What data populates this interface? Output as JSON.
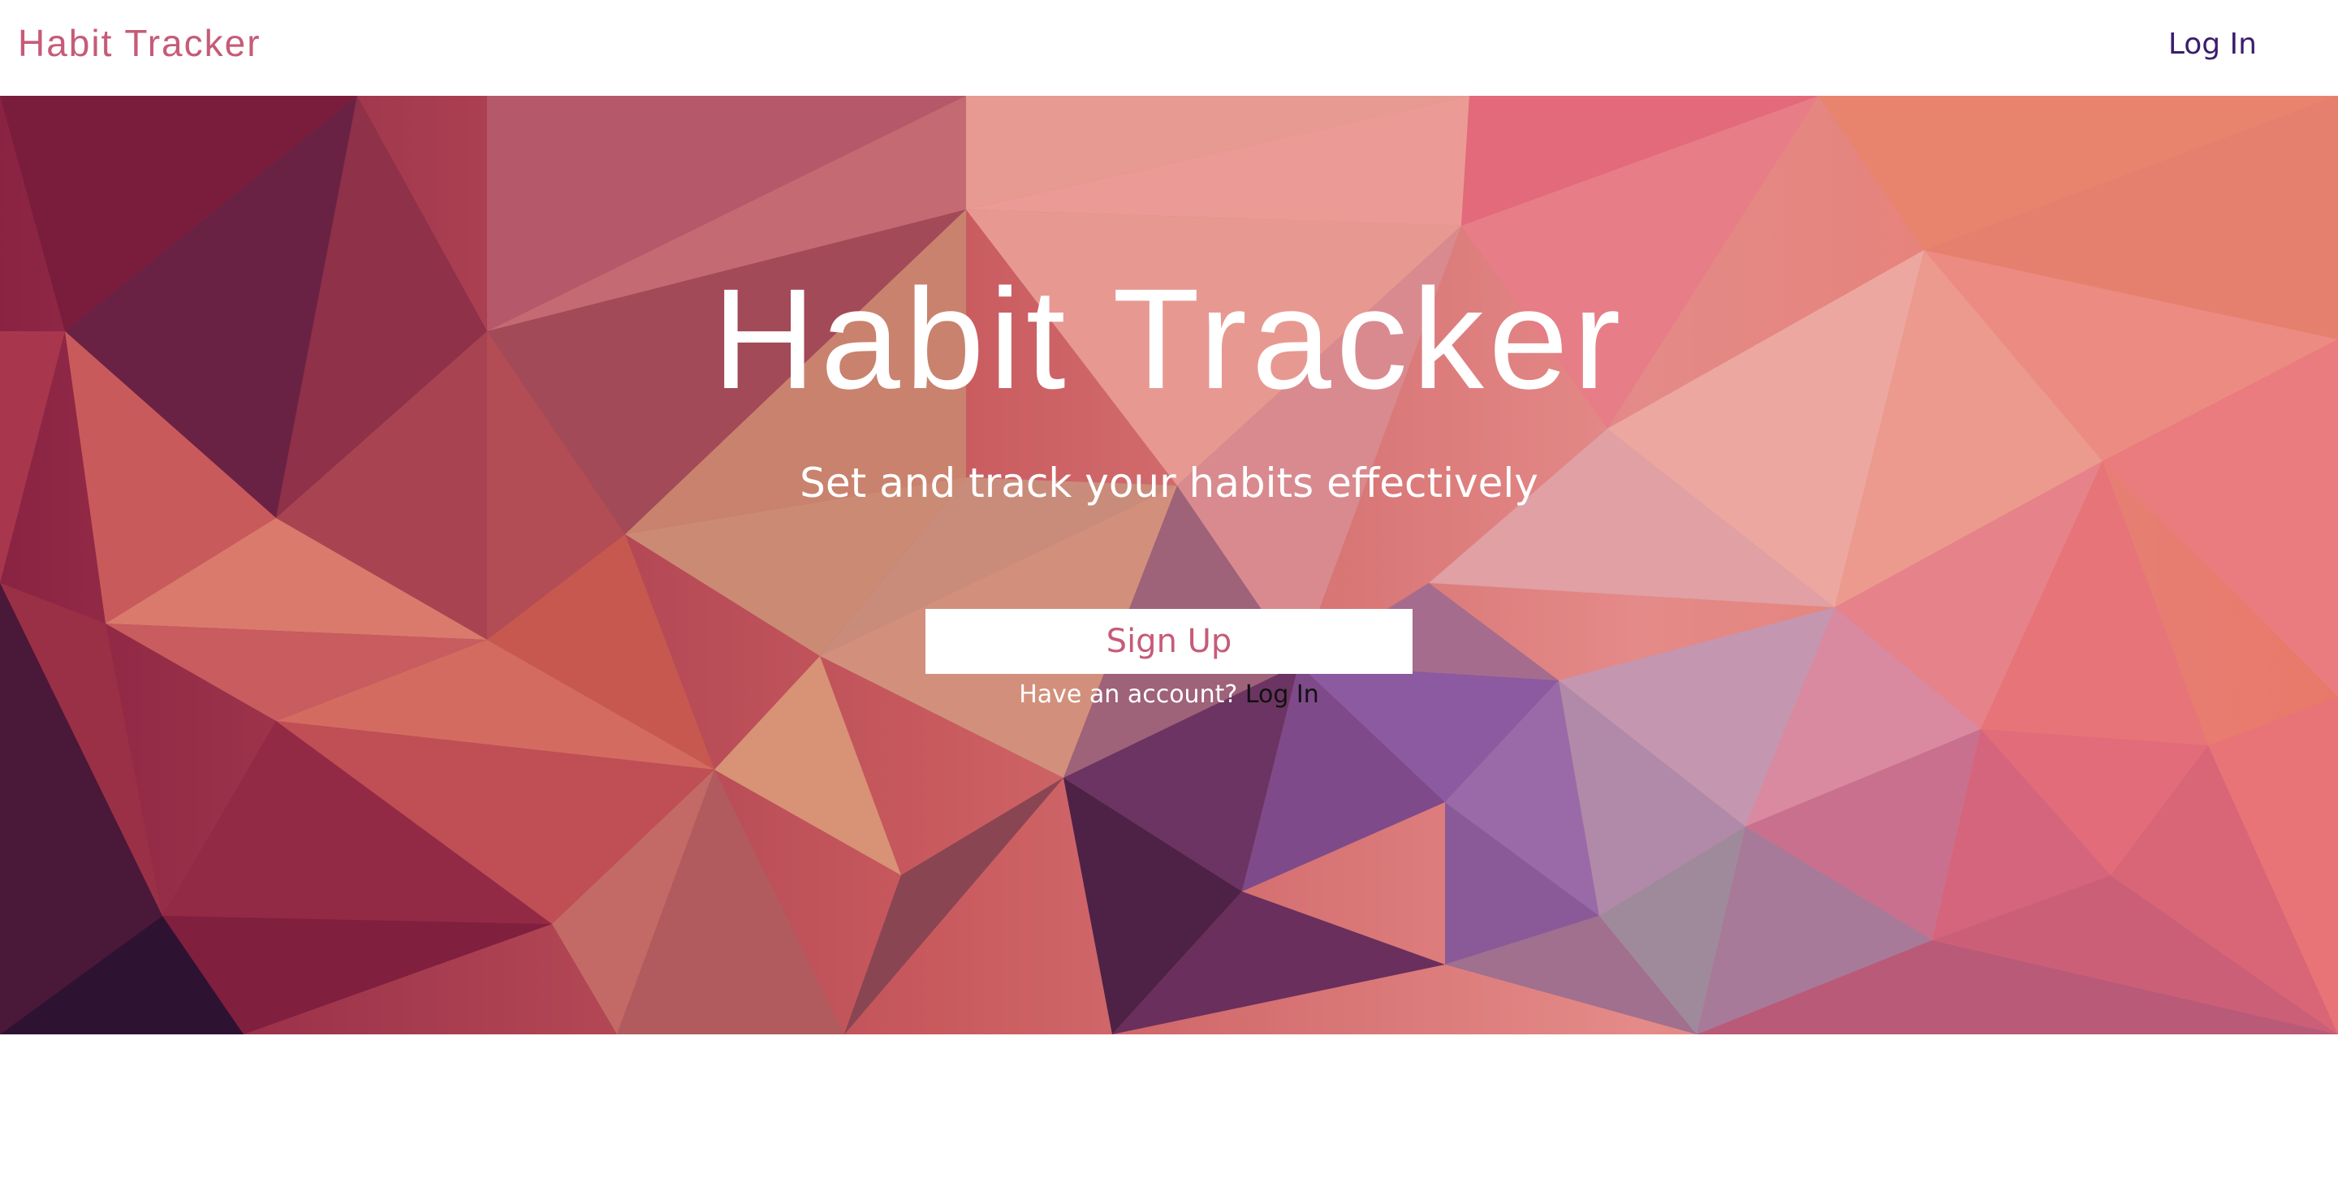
{
  "navbar": {
    "brand": "Habit Tracker",
    "login_label": "Log In"
  },
  "hero": {
    "title": "Habit Tracker",
    "subtitle": "Set and track your habits effectively",
    "signup_label": "Sign Up",
    "account_prompt": "Have an account?",
    "login_link_label": "Log In"
  },
  "colors": {
    "brand_pink": "#c65b78",
    "nav_link_purple": "#3b1d6e",
    "hero_bg_start": "#8a2343",
    "hero_bg_end": "#e8796a"
  }
}
